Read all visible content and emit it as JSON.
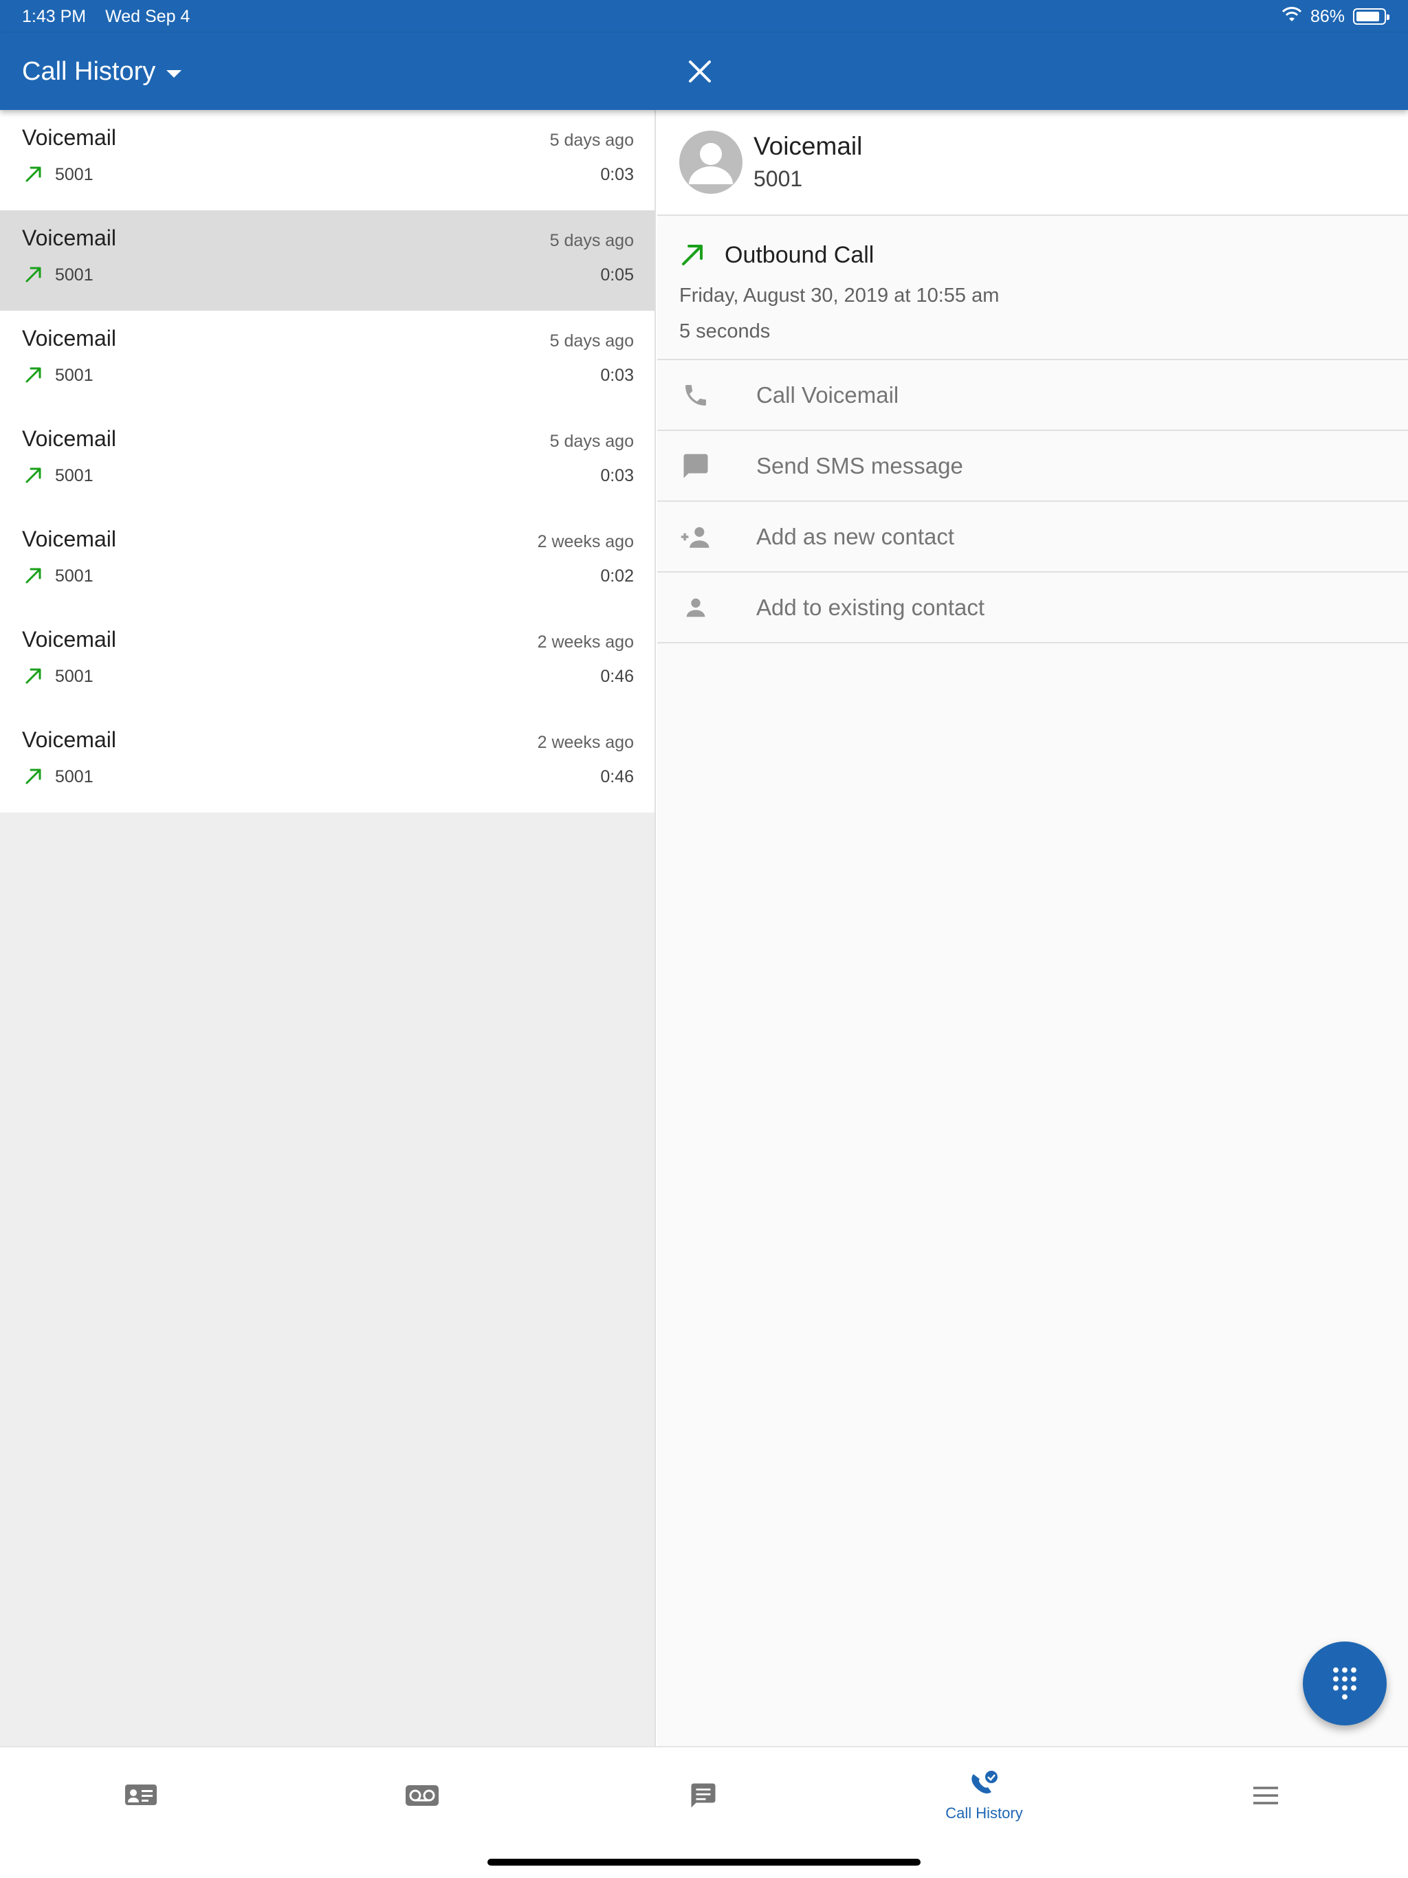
{
  "status_bar": {
    "time": "1:43 PM",
    "date": "Wed Sep 4",
    "battery": "86%",
    "battery_level": 0.86
  },
  "app_bar": {
    "title": "Call History"
  },
  "calls": [
    {
      "name": "Voicemail",
      "when": "5 days ago",
      "number": "5001",
      "duration": "0:03",
      "selected": false
    },
    {
      "name": "Voicemail",
      "when": "5 days ago",
      "number": "5001",
      "duration": "0:05",
      "selected": true
    },
    {
      "name": "Voicemail",
      "when": "5 days ago",
      "number": "5001",
      "duration": "0:03",
      "selected": false
    },
    {
      "name": "Voicemail",
      "when": "5 days ago",
      "number": "5001",
      "duration": "0:03",
      "selected": false
    },
    {
      "name": "Voicemail",
      "when": "2 weeks ago",
      "number": "5001",
      "duration": "0:02",
      "selected": false
    },
    {
      "name": "Voicemail",
      "when": "2 weeks ago",
      "number": "5001",
      "duration": "0:46",
      "selected": false
    },
    {
      "name": "Voicemail",
      "when": "2 weeks ago",
      "number": "5001",
      "duration": "0:46",
      "selected": false
    }
  ],
  "detail": {
    "name": "Voicemail",
    "number": "5001",
    "call_type": "Outbound Call",
    "date": "Friday, August 30, 2019 at 10:55 am",
    "length": "5 seconds",
    "actions": [
      {
        "label": "Call Voicemail",
        "icon": "phone-icon"
      },
      {
        "label": "Send SMS message",
        "icon": "message-icon"
      },
      {
        "label": "Add as new contact",
        "icon": "add-person-icon"
      },
      {
        "label": "Add to existing contact",
        "icon": "person-icon"
      }
    ]
  },
  "tabs": [
    {
      "label": "",
      "icon": "contacts-card-icon",
      "active": false
    },
    {
      "label": "",
      "icon": "voicemail-icon",
      "active": false
    },
    {
      "label": "",
      "icon": "chat-icon",
      "active": false
    },
    {
      "label": "Call History",
      "icon": "call-history-icon",
      "active": true
    },
    {
      "label": "",
      "icon": "menu-icon",
      "active": false
    }
  ],
  "colors": {
    "primary": "#1e66b3",
    "outbound_arrow": "#1aa01a",
    "selected_row": "#dcdcdc"
  }
}
